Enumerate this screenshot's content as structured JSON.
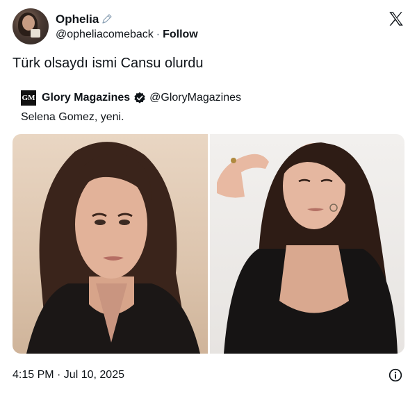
{
  "author": {
    "name": "Ophelia",
    "handle": "@opheliacomeback",
    "separator": "·",
    "follow_label": "Follow",
    "avatar_icon": "avatar-image",
    "edit_icon": "pencil-icon"
  },
  "brand_icon": "x-logo-icon",
  "tweet": {
    "text": "Türk olsaydı ismi Cansu olurdu"
  },
  "quoted": {
    "logo_text": "GM",
    "name": "Glory Magazines",
    "verified_icon": "verified-badge-icon",
    "handle": "@GloryMagazines",
    "text": "Selena Gomez, yeni."
  },
  "media": [
    {
      "description_icon": "photo-portrait-left"
    },
    {
      "description_icon": "photo-portrait-right"
    }
  ],
  "footer": {
    "timestamp": "4:15 PM · Jul 10, 2025",
    "info_icon": "info-icon"
  },
  "colors": {
    "text": "#0f1419",
    "secondary": "#536471",
    "background": "#ffffff"
  }
}
